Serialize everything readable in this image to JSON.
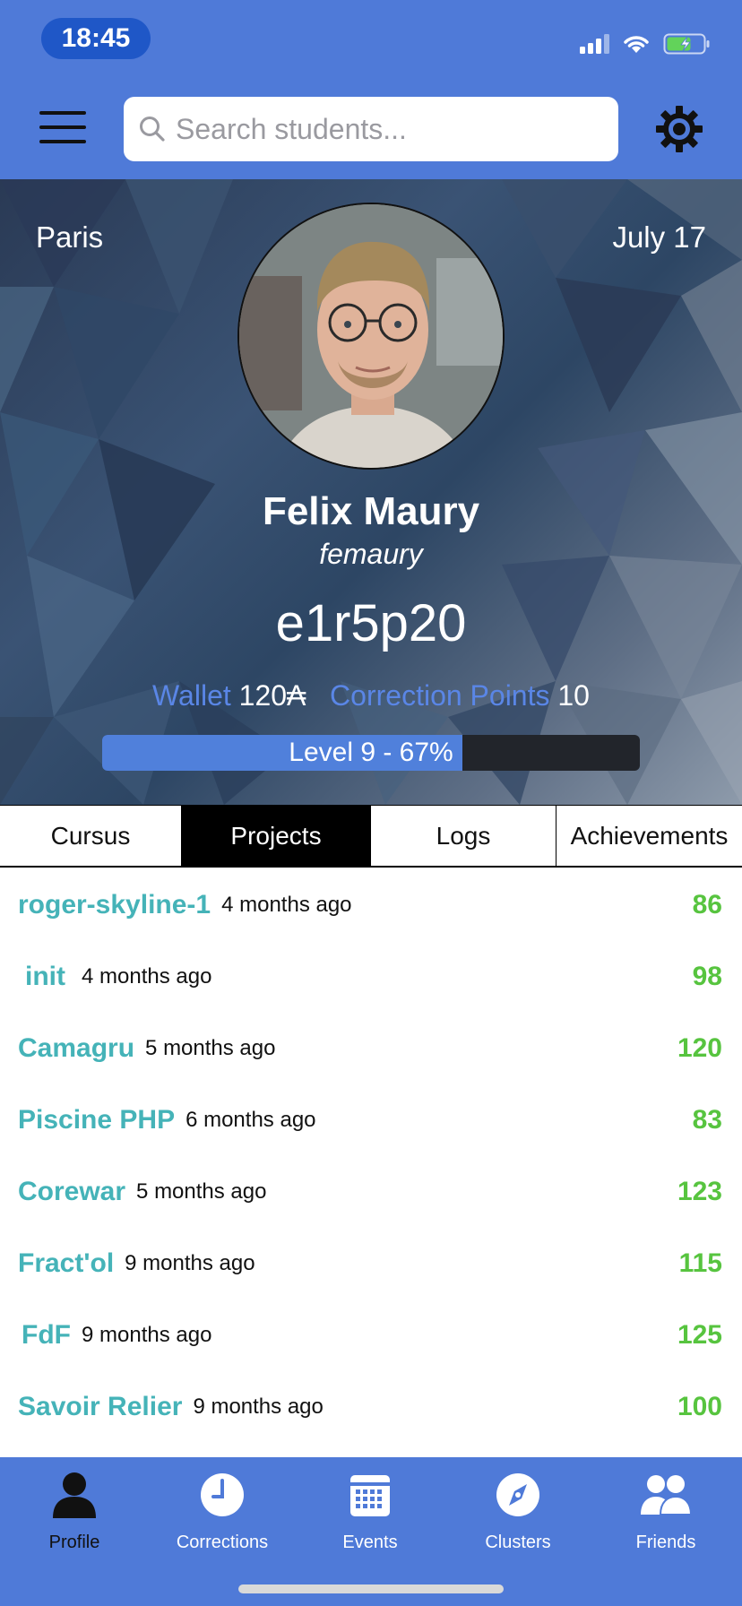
{
  "status_bar": {
    "time": "18:45"
  },
  "search": {
    "placeholder": "Search students..."
  },
  "profile": {
    "campus": "Paris",
    "date": "July 17",
    "name": "Felix Maury",
    "login": "femaury",
    "location": "e1r5p20",
    "wallet_label": "Wallet",
    "wallet_value": "120₳",
    "correction_label": "Correction Points",
    "correction_value": "10",
    "level_text": "Level 9 - 67%",
    "level_progress_percent": 67
  },
  "tabs": [
    {
      "label": "Cursus"
    },
    {
      "label": "Projects"
    },
    {
      "label": "Logs"
    },
    {
      "label": "Achievements"
    }
  ],
  "active_tab": "Projects",
  "projects": [
    {
      "name": "roger-skyline-1",
      "ago": "4 months ago",
      "grade": "86"
    },
    {
      "name": "init",
      "ago": "4 months ago",
      "grade": "98"
    },
    {
      "name": "Camagru",
      "ago": "5 months ago",
      "grade": "120"
    },
    {
      "name": "Piscine PHP",
      "ago": "6 months ago",
      "grade": "83"
    },
    {
      "name": "Corewar",
      "ago": "5 months ago",
      "grade": "123"
    },
    {
      "name": "Fract'ol",
      "ago": "9 months ago",
      "grade": "115"
    },
    {
      "name": "FdF",
      "ago": "9 months ago",
      "grade": "125"
    },
    {
      "name": "Savoir Relier",
      "ago": "9 months ago",
      "grade": "100"
    }
  ],
  "tabbar": [
    {
      "label": "Profile",
      "icon": "person-icon"
    },
    {
      "label": "Corrections",
      "icon": "clock-icon"
    },
    {
      "label": "Events",
      "icon": "calendar-icon"
    },
    {
      "label": "Clusters",
      "icon": "compass-icon"
    },
    {
      "label": "Friends",
      "icon": "people-icon"
    }
  ],
  "colors": {
    "header_blue": "#4f7ad8",
    "project_name": "#45b3b8",
    "grade_green": "#57c43f",
    "stat_label_blue": "#5a86e6"
  }
}
